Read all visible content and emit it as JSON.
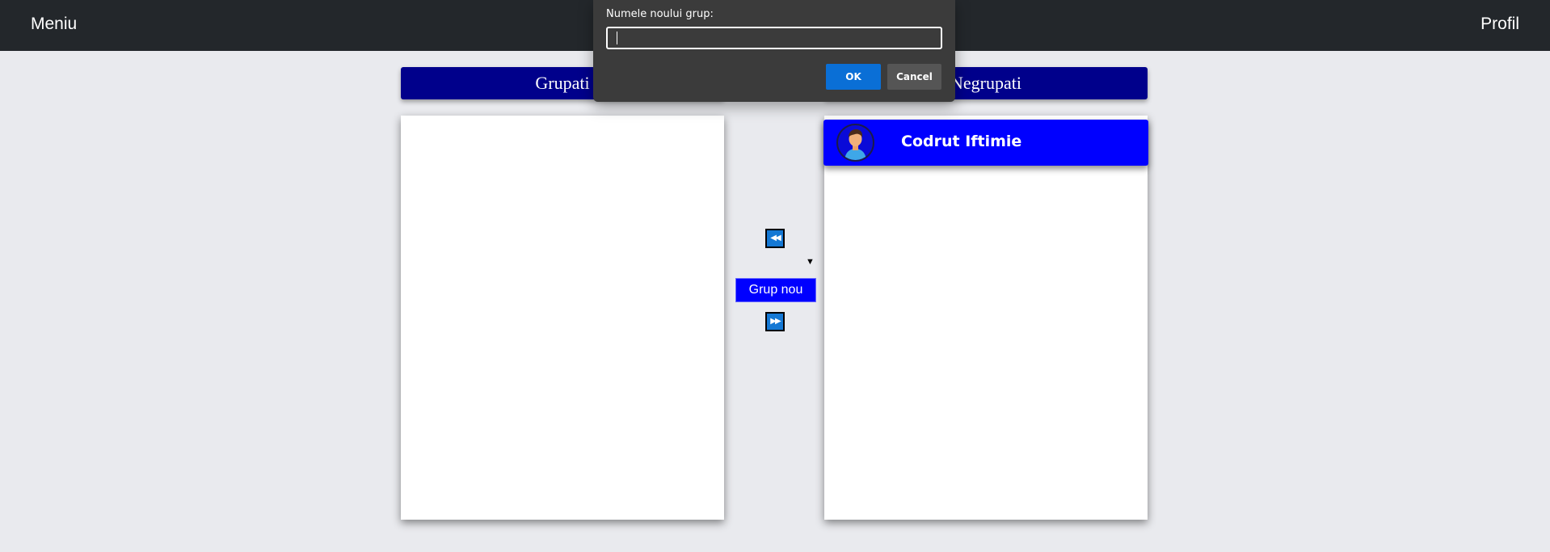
{
  "navbar": {
    "menu_label": "Meniu",
    "profile_label": "Profil"
  },
  "columns": {
    "grouped_title": "Grupati",
    "ungrouped_title": "Negrupati"
  },
  "users": [
    {
      "name": "Codrut Iftimie",
      "avatar": "user-avatar-icon"
    }
  ],
  "controls": {
    "move_left_icon": "◀◀",
    "move_right_icon": "▶▶",
    "dropdown_caret": "▼",
    "new_group_label": "Grup nou"
  },
  "dialog": {
    "label": "Numele noului grup:",
    "input_value": "",
    "ok_label": "OK",
    "cancel_label": "Cancel"
  },
  "colors": {
    "navbar": "#23272b",
    "header": "#00008b",
    "user_card": "#0000ff",
    "ok_button": "#0a6fd6"
  }
}
